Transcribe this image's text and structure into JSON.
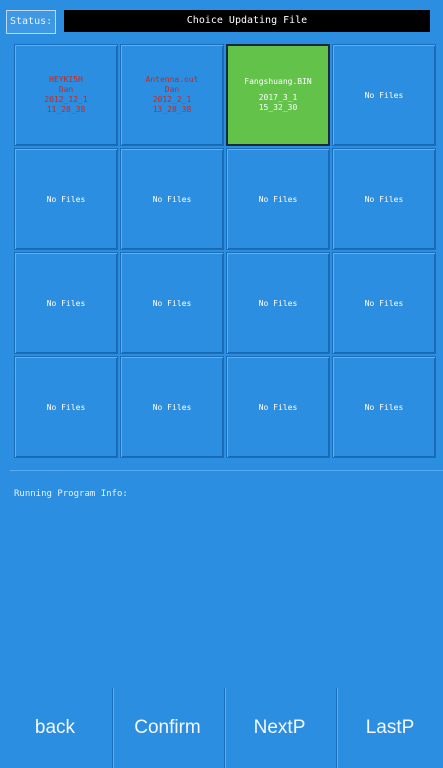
{
  "status": {
    "label": "Status:",
    "title": "Choice Updating File"
  },
  "files": [
    {
      "lines": [
        "HEYKI5H",
        "Dan",
        "2012_12_1",
        "11_28_38"
      ],
      "selected": false,
      "has_file": true
    },
    {
      "lines": [
        "Antenna.out",
        "Dan",
        "2012_2_1",
        "13_28_38"
      ],
      "selected": false,
      "has_file": true
    },
    {
      "lines": [
        "Fangshuang.BIN",
        "2017_3_1",
        "15_32_30"
      ],
      "selected": true,
      "has_file": true
    },
    {
      "lines": [
        "No Files"
      ],
      "selected": false,
      "has_file": false
    },
    {
      "lines": [
        "No Files"
      ],
      "selected": false,
      "has_file": false
    },
    {
      "lines": [
        "No Files"
      ],
      "selected": false,
      "has_file": false
    },
    {
      "lines": [
        "No Files"
      ],
      "selected": false,
      "has_file": false
    },
    {
      "lines": [
        "No Files"
      ],
      "selected": false,
      "has_file": false
    },
    {
      "lines": [
        "No Files"
      ],
      "selected": false,
      "has_file": false
    },
    {
      "lines": [
        "No Files"
      ],
      "selected": false,
      "has_file": false
    },
    {
      "lines": [
        "No Files"
      ],
      "selected": false,
      "has_file": false
    },
    {
      "lines": [
        "No Files"
      ],
      "selected": false,
      "has_file": false
    },
    {
      "lines": [
        "No Files"
      ],
      "selected": false,
      "has_file": false
    },
    {
      "lines": [
        "No Files"
      ],
      "selected": false,
      "has_file": false
    },
    {
      "lines": [
        "No Files"
      ],
      "selected": false,
      "has_file": false
    },
    {
      "lines": [
        "No Files"
      ],
      "selected": false,
      "has_file": false
    }
  ],
  "info": {
    "label": "Running Program Info:"
  },
  "buttons": {
    "back": "back",
    "confirm": "Confirm",
    "next": "NextP",
    "last": "LastP"
  }
}
